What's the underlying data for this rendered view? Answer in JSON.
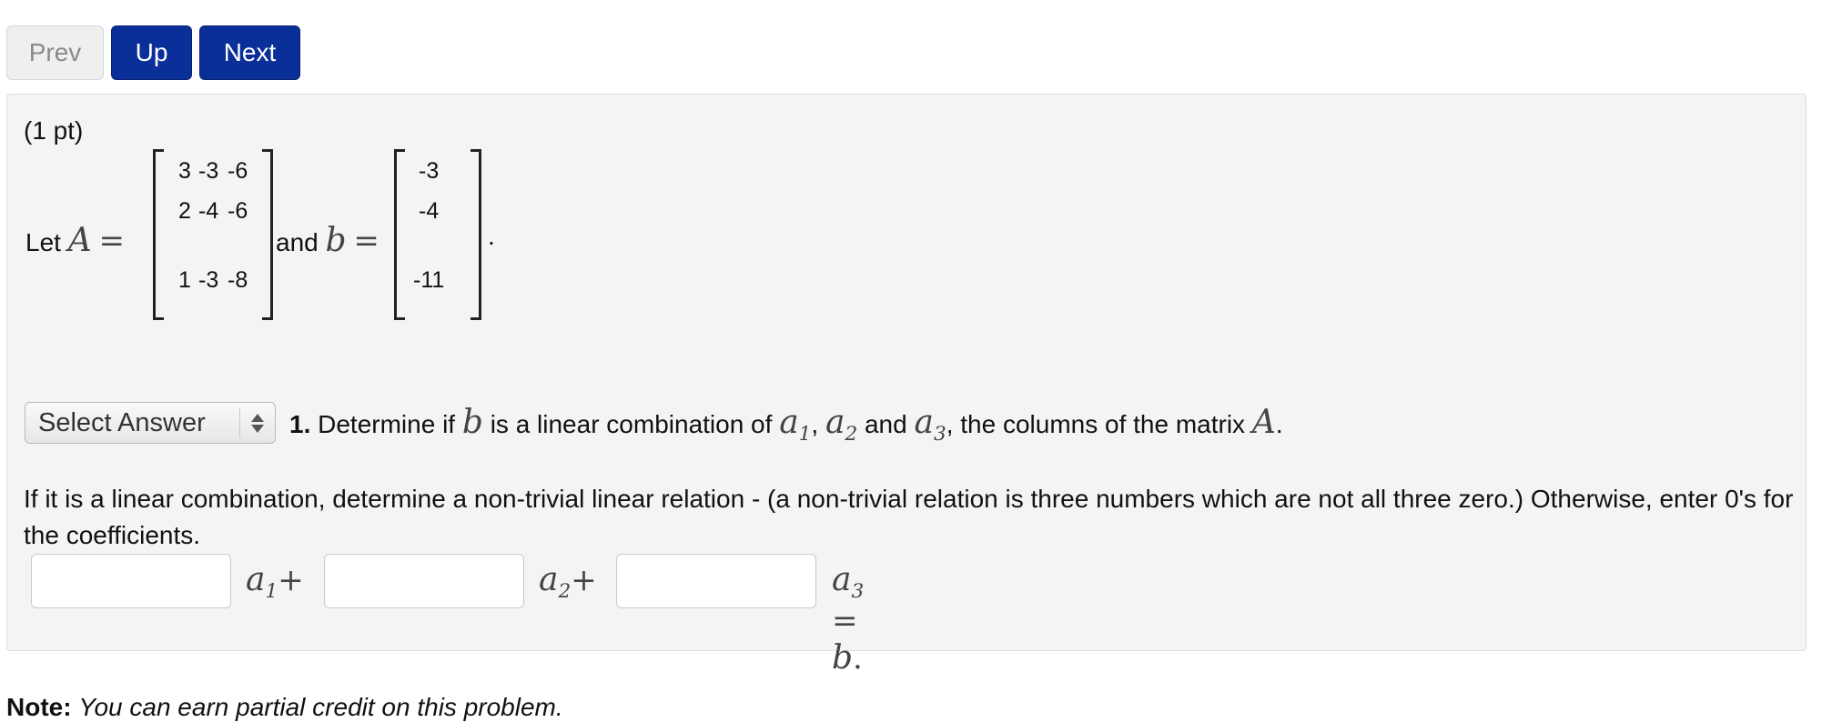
{
  "nav": {
    "prev": "Prev",
    "up": "Up",
    "next": "Next"
  },
  "problem": {
    "points": "(1 pt)",
    "let_text": "Let",
    "and_text": "and",
    "A": {
      "rows": [
        [
          "3",
          "-3",
          "-6"
        ],
        [
          "2",
          "-4",
          "-6"
        ],
        [
          "1",
          "-3",
          "-8"
        ]
      ]
    },
    "b": {
      "rows": [
        "-3",
        "-4",
        "-11"
      ]
    },
    "select": {
      "value": "Select Answer"
    },
    "question_number": "1.",
    "question_text_1": "Determine if",
    "question_text_2": "is a linear combination of",
    "question_text_3": "and",
    "question_text_4": ", the columns of the matrix",
    "instruction": "If it is a linear combination, determine a non-trivial linear relation - (a non-trivial relation is three numbers which are not all three zero.) Otherwise, enter 0's for the coefficients.",
    "inputs": {
      "c1": "",
      "c2": "",
      "c3": ""
    }
  },
  "note": {
    "label": "Note:",
    "text": "You can earn partial credit on this problem."
  },
  "colors": {
    "nav_blue": "#0b2f99",
    "panel_bg": "#f4f4f4"
  }
}
